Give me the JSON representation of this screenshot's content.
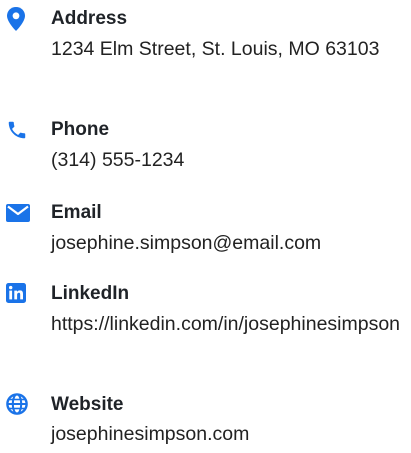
{
  "contacts": {
    "address": {
      "icon": "map-pin-icon",
      "label": "Address",
      "value": "1234 Elm Street, St. Louis, MO 63103"
    },
    "phone": {
      "icon": "phone-icon",
      "label": "Phone",
      "value": "(314) 555-1234"
    },
    "email": {
      "icon": "envelope-icon",
      "label": "Email",
      "value": "josephine.simpson@email.com"
    },
    "linkedin": {
      "icon": "linkedin-icon",
      "label": "LinkedIn",
      "value": "https://linkedin.com/in/josephinesimpson"
    },
    "website": {
      "icon": "globe-icon",
      "label": "Website",
      "value": "josephinesimpson.com"
    }
  },
  "colors": {
    "icon": "#1a73e8",
    "label": "#1f2328",
    "text": "#222222"
  }
}
